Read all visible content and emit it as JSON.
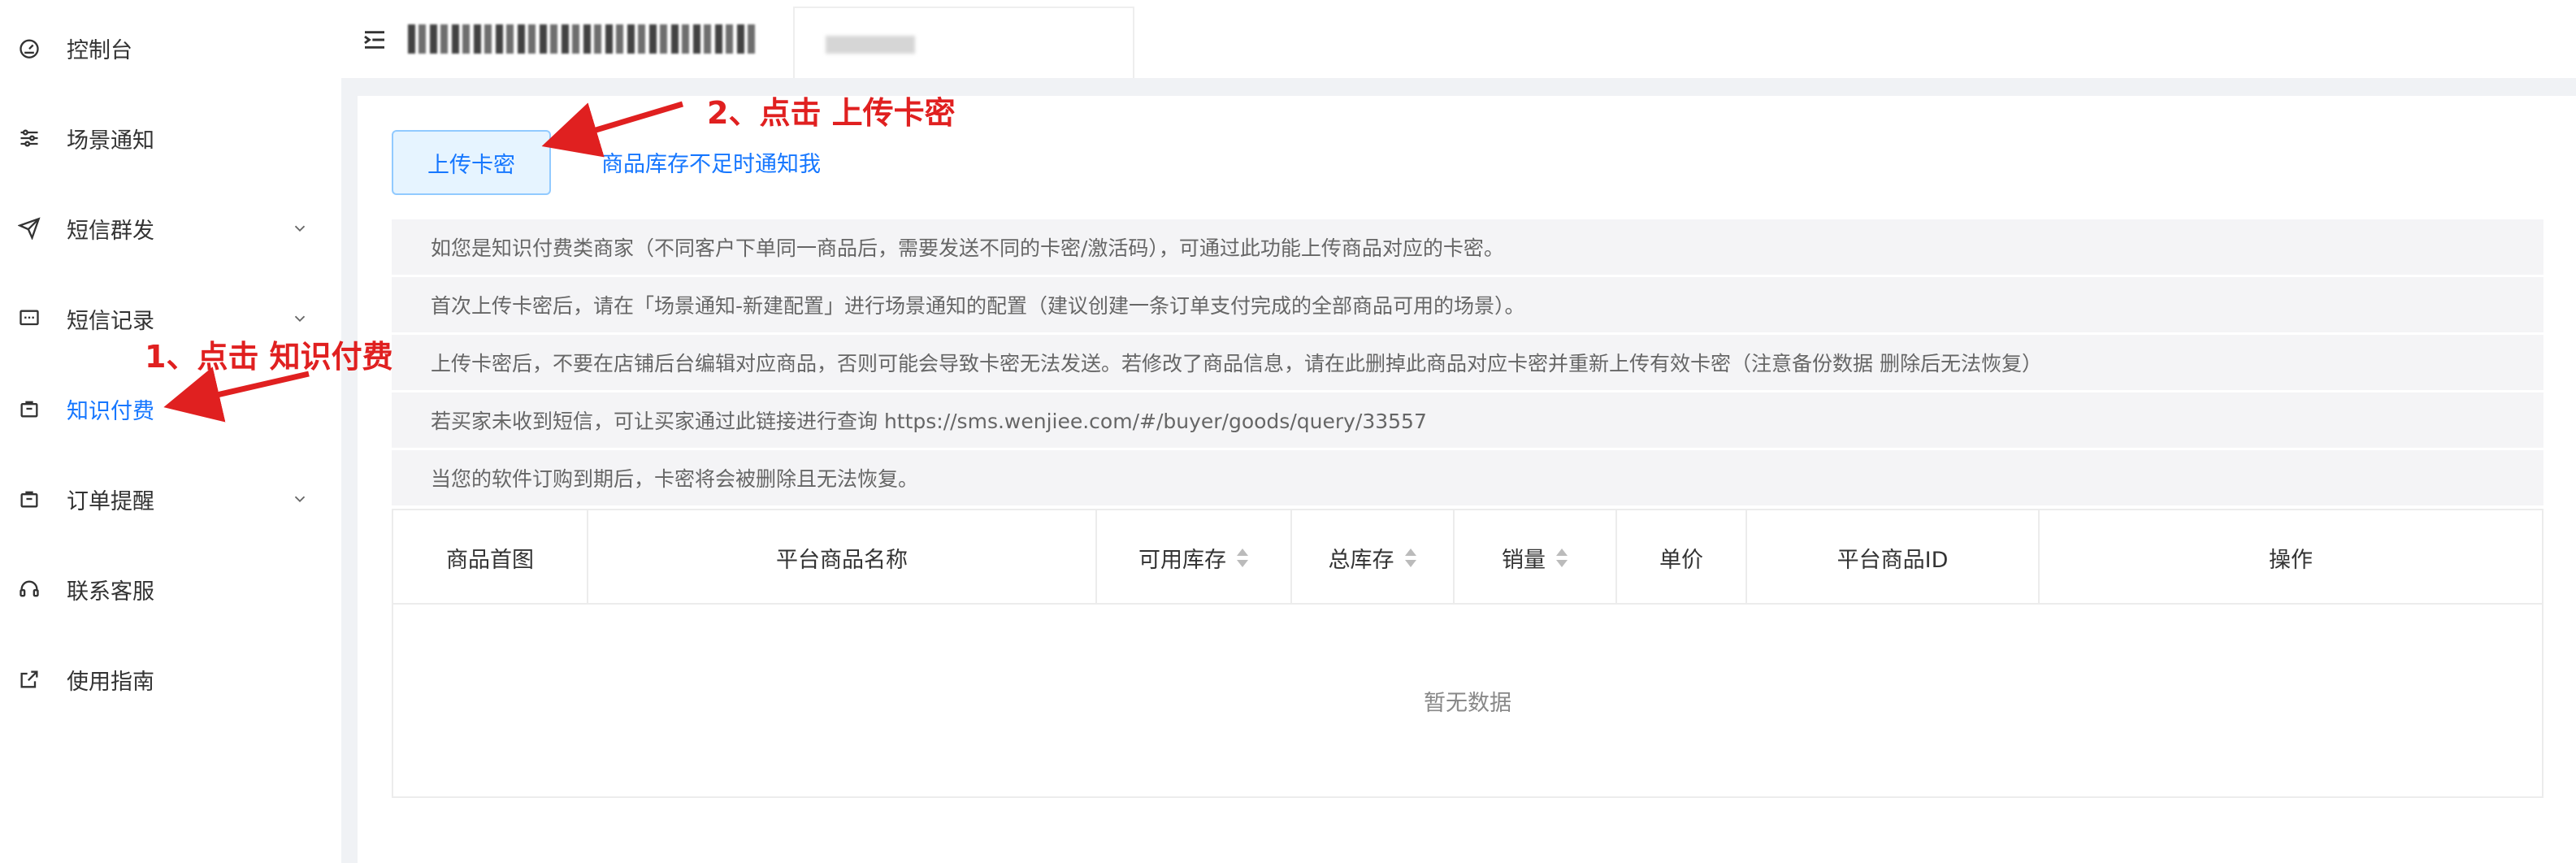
{
  "sidebar": {
    "items": [
      {
        "label": "控制台",
        "icon": "dashboard-icon",
        "has_chevron": false,
        "active": false
      },
      {
        "label": "场景通知",
        "icon": "sliders-icon",
        "has_chevron": false,
        "active": false
      },
      {
        "label": "短信群发",
        "icon": "send-icon",
        "has_chevron": true,
        "active": false
      },
      {
        "label": "短信记录",
        "icon": "message-icon",
        "has_chevron": true,
        "active": false
      },
      {
        "label": "知识付费",
        "icon": "shopping-bag-icon",
        "has_chevron": false,
        "active": true
      },
      {
        "label": "订单提醒",
        "icon": "shopping-bag-icon",
        "has_chevron": true,
        "active": false
      },
      {
        "label": "联系客服",
        "icon": "headset-icon",
        "has_chevron": false,
        "active": false
      },
      {
        "label": "使用指南",
        "icon": "external-link-icon",
        "has_chevron": false,
        "active": false
      }
    ]
  },
  "main": {
    "upload_button": "上传卡密",
    "notify_link": "商品库存不足时通知我",
    "notices": [
      "如您是知识付费类商家（不同客户下单同一商品后，需要发送不同的卡密/激活码），可通过此功能上传商品对应的卡密。",
      "首次上传卡密后，请在「场景通知-新建配置」进行场景通知的配置（建议创建一条订单支付完成的全部商品可用的场景）。",
      "上传卡密后，不要在店铺后台编辑对应商品，否则可能会导致卡密无法发送。若修改了商品信息，请在此删掉此商品对应卡密并重新上传有效卡密（注意备份数据 删除后无法恢复）",
      "若买家未收到短信，可让买家通过此链接进行查询 https://sms.wenjiee.com/#/buyer/goods/query/33557",
      "当您的软件订购到期后，卡密将会被删除且无法恢复。"
    ],
    "table": {
      "columns": [
        {
          "label": "商品首图",
          "sortable": false
        },
        {
          "label": "平台商品名称",
          "sortable": false
        },
        {
          "label": "可用库存",
          "sortable": true
        },
        {
          "label": "总库存",
          "sortable": true
        },
        {
          "label": "销量",
          "sortable": true
        },
        {
          "label": "单价",
          "sortable": false
        },
        {
          "label": "平台商品ID",
          "sortable": false
        },
        {
          "label": "操作",
          "sortable": false
        }
      ],
      "empty_text": "暂无数据"
    }
  },
  "annotations": {
    "step1": "1、点击 知识付费",
    "step2": "2、点击 上传卡密",
    "color": "#e02020"
  },
  "colors": {
    "accent": "#1677ff",
    "annotation": "#e02020"
  }
}
